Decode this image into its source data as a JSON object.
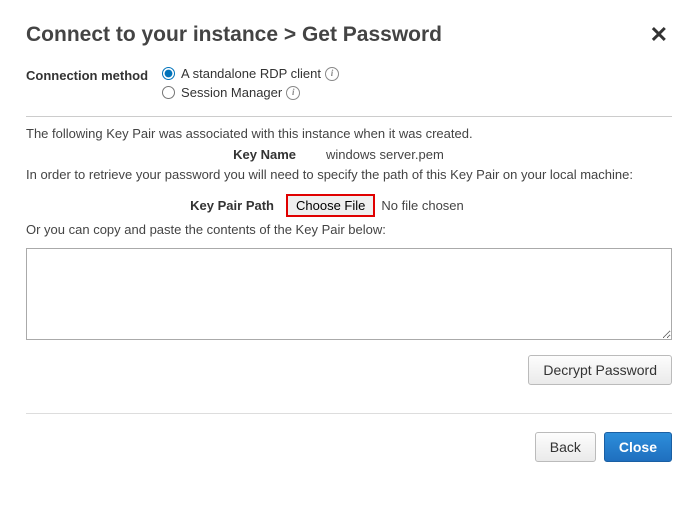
{
  "header": {
    "title": "Connect to your instance > Get Password"
  },
  "connection": {
    "label": "Connection method",
    "options": {
      "rdp": "A standalone RDP client",
      "ssm": "Session Manager"
    }
  },
  "body": {
    "intro": "The following Key Pair was associated with this instance when it was created.",
    "key_name_label": "Key Name",
    "key_name_value": "windows server.pem",
    "retrieve_text": "In order to retrieve your password you will need to specify the path of this Key Pair on your local machine:",
    "key_pair_path_label": "Key Pair Path",
    "choose_file_label": "Choose File",
    "file_status": "No file chosen",
    "paste_text": "Or you can copy and paste the contents of the Key Pair below:"
  },
  "buttons": {
    "decrypt": "Decrypt Password",
    "back": "Back",
    "close": "Close"
  }
}
